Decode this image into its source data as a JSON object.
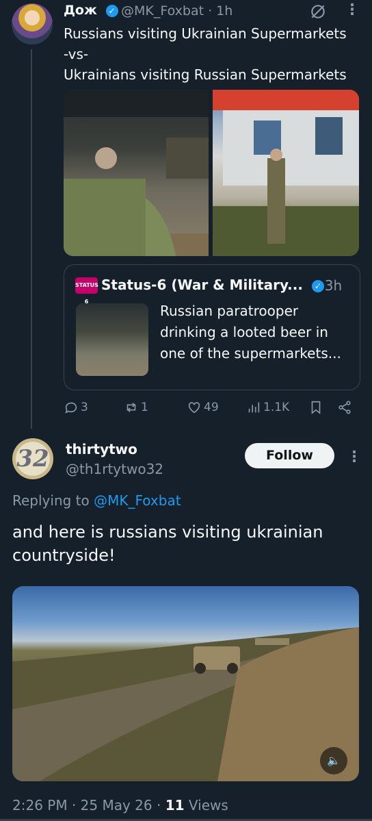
{
  "parent": {
    "display_name": "Дож",
    "handle": "@MK_Foxbat",
    "time": "· 1h",
    "text": "Russians visiting Ukrainian Supermarkets\n-vs-\nUkrainians visiting Russian Supermarkets",
    "quote": {
      "badge": "STATUS 6",
      "display_name": "Status-6 (War & Military...",
      "time": "· 3h",
      "text": "Russian paratrooper drinking a looted beer in one of the supermarkets..."
    },
    "actions": {
      "replies": "3",
      "reposts": "1",
      "likes": "49",
      "views": "1.1K"
    }
  },
  "reply": {
    "avatar_text": "32",
    "display_name": "thirtytwo",
    "handle": "@th1rtytwo32",
    "follow_label": "Follow",
    "replying_prefix": "Replying to",
    "replying_to": "@MK_Foxbat",
    "text": "and here is russians visiting ukrainian countryside!",
    "timestamp": "2:26 PM · 25 May 26 · ",
    "views_count": "11",
    "views_label": " Views"
  },
  "colors": {
    "background": "#15202b",
    "accent": "#1d9bf0",
    "muted": "#8b98a5"
  }
}
